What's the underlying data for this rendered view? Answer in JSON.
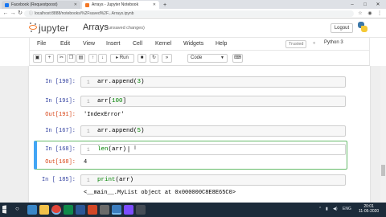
{
  "browser": {
    "tabs": [
      {
        "label": "Facebook (Requestpoost)",
        "favicon_color": "#1877f2"
      },
      {
        "label": "Arrays - Jupyter Notebook",
        "favicon_color": "#f37726"
      }
    ],
    "url": "localhost:8888/notebooks/%2Fsaved%2F...Arrays.ipynb",
    "window_controls": [
      "–",
      "□",
      "✕"
    ]
  },
  "header": {
    "app_name": "jupyter",
    "notebook_title": "Arrays",
    "save_status": "(unsaved changes)",
    "logout_label": "Logout"
  },
  "menu": {
    "items": [
      "File",
      "Edit",
      "View",
      "Insert",
      "Cell",
      "Kernel",
      "Widgets",
      "Help"
    ],
    "trusted_label": "Trusted",
    "kernel_name": "Python 3"
  },
  "toolbar": {
    "run_label": "Run",
    "cell_type": "Code",
    "icons": [
      "save-icon",
      "plus-icon",
      "cut-icon",
      "copy-icon",
      "paste-icon",
      "arrow-up-icon",
      "arrow-down-icon",
      "run-icon",
      "stop-icon",
      "restart-icon",
      "fast-forward-icon",
      "keyboard-icon"
    ]
  },
  "cells": [
    {
      "prompt": "In [190]:",
      "line": "1",
      "code_prefix": "arr.append(",
      "code_num": "3",
      "code_suffix": ")"
    },
    {
      "prompt": "In [191]:",
      "line": "1",
      "code_prefix": "arr[",
      "code_num": "100",
      "code_suffix": "]",
      "out_prompt": "Out[191]:",
      "output": "'IndexError'"
    },
    {
      "prompt": "In [167]:",
      "line": "1",
      "code_prefix": "arr.append(",
      "code_num": "5",
      "code_suffix": ")"
    },
    {
      "prompt": "In [168]:",
      "line": "1",
      "code_fn": "len",
      "code_rest": "(arr)",
      "out_prompt": "Out[168]:",
      "output": "4"
    },
    {
      "prompt": "In [ 185]:",
      "line": "1",
      "code_fn": "print",
      "code_rest": "(arr)",
      "output": "<__main__.MyList object at 0x000000C8E8E65C0>"
    }
  ],
  "taskbar": {
    "time": "20:01",
    "date": "11-05-2020",
    "lang": "ENG"
  },
  "colors": {
    "jupyter_orange": "#f37726",
    "in_prompt": "#303f9f",
    "out_prompt": "#d84315",
    "selected_border": "#66bb6a",
    "selected_bar": "#42a5f5"
  }
}
